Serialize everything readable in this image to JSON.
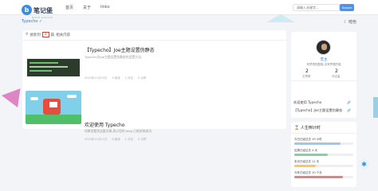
{
  "header": {
    "logo_letter": "b",
    "logo_title": "笔记堡",
    "logo_subtitle": "NOTE CASTLE",
    "nav": [
      "首页",
      "关于",
      "links"
    ],
    "search_placeholder": "请输入关键字...",
    "search_button": "Search"
  },
  "subbar": {
    "left_label": "Typecho ✓",
    "right_label": "☾ 暗色"
  },
  "breadcrumb": {
    "items": [
      "搜索到",
      "2",
      "篇",
      "相关内容"
    ]
  },
  "posts": [
    {
      "title": "【Typecho】Joe主题设置伪静态",
      "desc": "Typecho为Joe主题设置伪静态的设置方法。",
      "meta": [
        "2024年11月15日",
        "5 阅读",
        "1 评论",
        "0 点赞"
      ]
    },
    {
      "title": "欢迎使用 Typecho",
      "desc": "如果您看到这篇文章,表示您的 blog 已经安装成功.",
      "meta": [
        "2024年11月11日",
        "8 阅读",
        "1 评论",
        "0 点赞"
      ]
    }
  ],
  "profile": {
    "name": "堡主",
    "motto": "有梦想的酸猫,没有梦想的猫",
    "articles_count": "2",
    "articles_label": "文章数",
    "comments_count": "2",
    "comments_label": "评论量",
    "links": [
      "欢迎使用 Typecho",
      "【Typecho】Joe主题设置伪静态"
    ]
  },
  "life": {
    "title": "人生倒计时",
    "items": [
      {
        "label": "今日已经过去 19 小时",
        "fraction": 0.79,
        "color": "#9fc5f0"
      },
      {
        "label": "这周已经过去 4 天",
        "fraction": 0.57,
        "color": "#7fd3a0"
      },
      {
        "label": "本月已经过去 11 天",
        "fraction": 0.36,
        "color": "#f4c76a"
      },
      {
        "label": "今年已经过去 10 个月",
        "fraction": 0.83,
        "color": "#e88080"
      }
    ]
  },
  "colors": {
    "accent": "#4c93ec",
    "highlight": "#e53935"
  },
  "icons": {
    "theme_toggle": "moon-icon",
    "float_button": "settings-icon"
  }
}
